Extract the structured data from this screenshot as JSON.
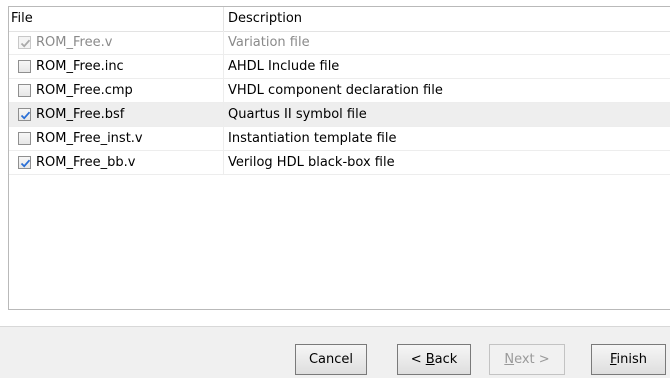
{
  "table": {
    "columns": {
      "file": "File",
      "description": "Description"
    },
    "rows": [
      {
        "file": "ROM_Free.v",
        "description": "Variation file",
        "checked": true,
        "disabled": true
      },
      {
        "file": "ROM_Free.inc",
        "description": "AHDL Include file",
        "checked": false,
        "disabled": false
      },
      {
        "file": "ROM_Free.cmp",
        "description": "VHDL component declaration file",
        "checked": false,
        "disabled": false
      },
      {
        "file": "ROM_Free.bsf",
        "description": "Quartus II symbol file",
        "checked": true,
        "disabled": false
      },
      {
        "file": "ROM_Free_inst.v",
        "description": "Instantiation template file",
        "checked": false,
        "disabled": false
      },
      {
        "file": "ROM_Free_bb.v",
        "description": "Verilog HDL black-box file",
        "checked": true,
        "disabled": false
      }
    ]
  },
  "buttons": {
    "cancel": "Cancel",
    "back_prefix": "< ",
    "back_accel": "B",
    "back_rest": "ack",
    "next_accel": "N",
    "next_rest": "ext >",
    "finish_accel": "F",
    "finish_rest": "inish"
  },
  "colors": {
    "check": "#2a6fd6",
    "disabled_check": "#a9a9a9"
  }
}
